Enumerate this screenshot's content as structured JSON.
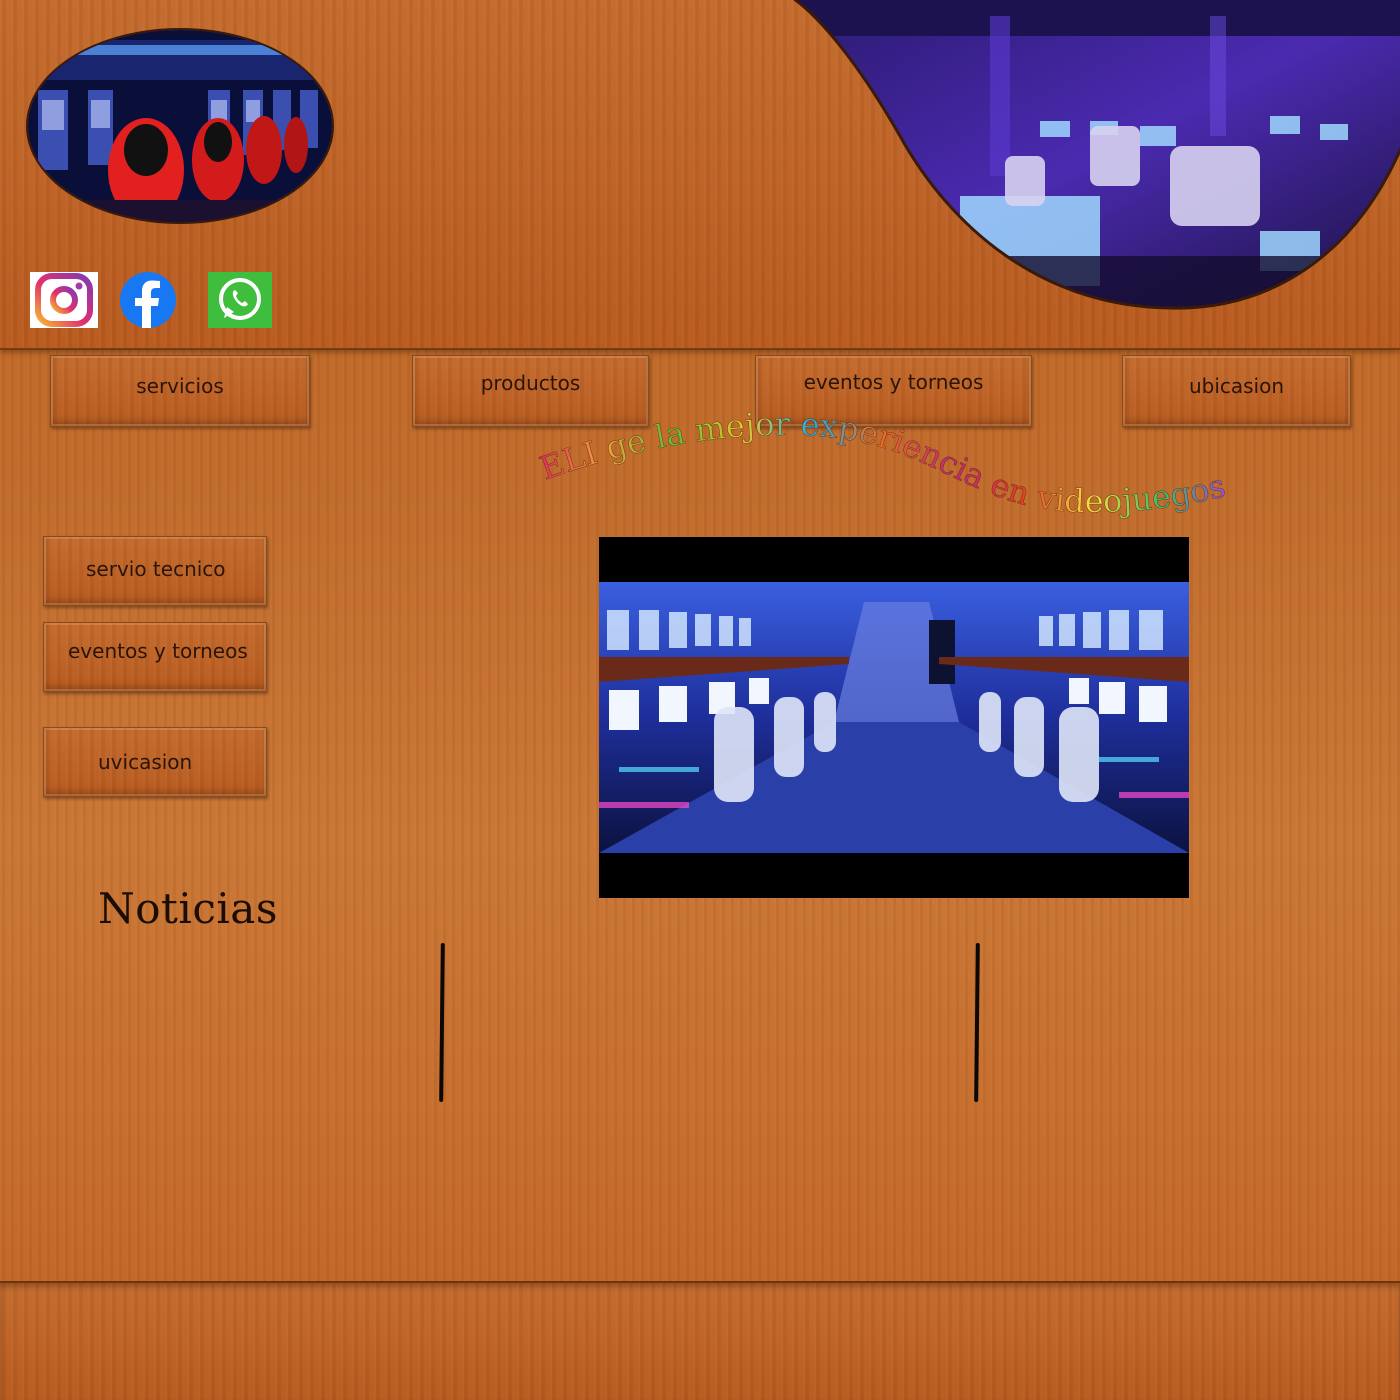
{
  "header": {
    "logo_alt": "gaming arcade chairs",
    "hero_alt": "gaming lounge"
  },
  "social": [
    {
      "name": "Instagram"
    },
    {
      "name": "Facebook"
    },
    {
      "name": "WhatsApp"
    }
  ],
  "nav": {
    "items": [
      {
        "label": "servicios"
      },
      {
        "label": "productos"
      },
      {
        "label": "eventos y torneos"
      },
      {
        "label": "ubicasion"
      }
    ]
  },
  "tagline": {
    "text": "ELI ge la mejor experiencia en videojuegos"
  },
  "sidebar": {
    "items": [
      {
        "label": "servio tecnico"
      },
      {
        "label": "eventos y torneos"
      },
      {
        "label": "uvicasion"
      }
    ]
  },
  "news": {
    "title": "Noticias"
  },
  "colors": {
    "wood_base": "#c46a2c",
    "wood_dark": "#7a3a10",
    "text_dark": "#2a1508"
  }
}
